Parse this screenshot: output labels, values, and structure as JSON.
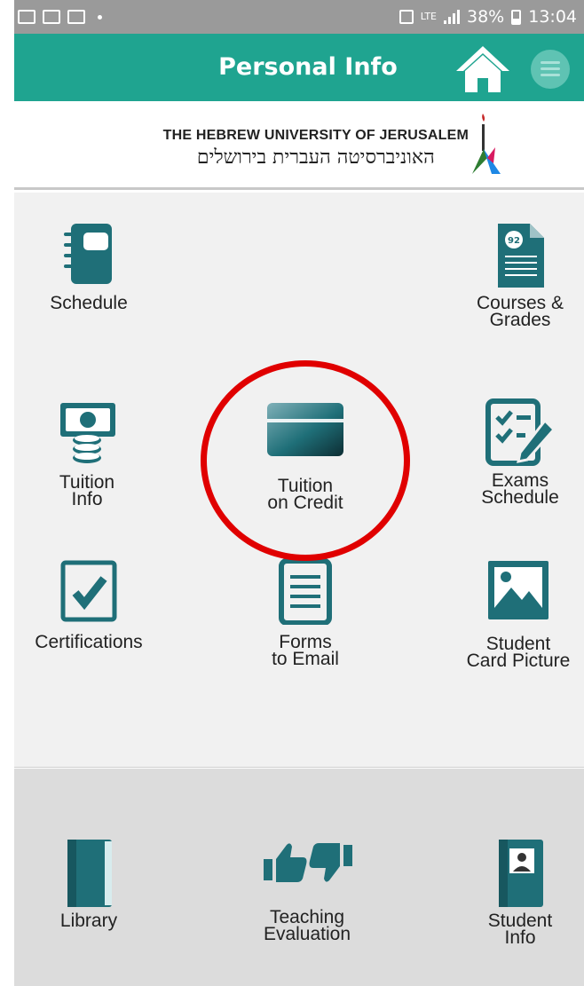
{
  "status_bar": {
    "lte": "LTE",
    "battery": "38%",
    "time": "13:04"
  },
  "header": {
    "title": "Personal Info"
  },
  "logo": {
    "english": "THE HEBREW UNIVERSITY OF JERUSALEM",
    "hebrew": "האוניברסיטה העברית בירושלים"
  },
  "menu": {
    "schedule": "Schedule",
    "courses_grades": "Courses &\nGrades",
    "course_badge": "92",
    "tuition_info": "Tuition\nInfo",
    "tuition_credit": "Tuition\non Credit",
    "exams_schedule": "Exams\nSchedule",
    "certifications": "Certifications",
    "forms_email": "Forms\nto Email",
    "student_card": "Student\nCard Picture"
  },
  "bottom": {
    "library": "Library",
    "teaching_evaluation": "Teaching\nEvaluation",
    "student_info": "Student\nInfo"
  },
  "colors": {
    "header": "#1fa490",
    "icon": "#1f6f78",
    "highlight": "#e00000"
  }
}
